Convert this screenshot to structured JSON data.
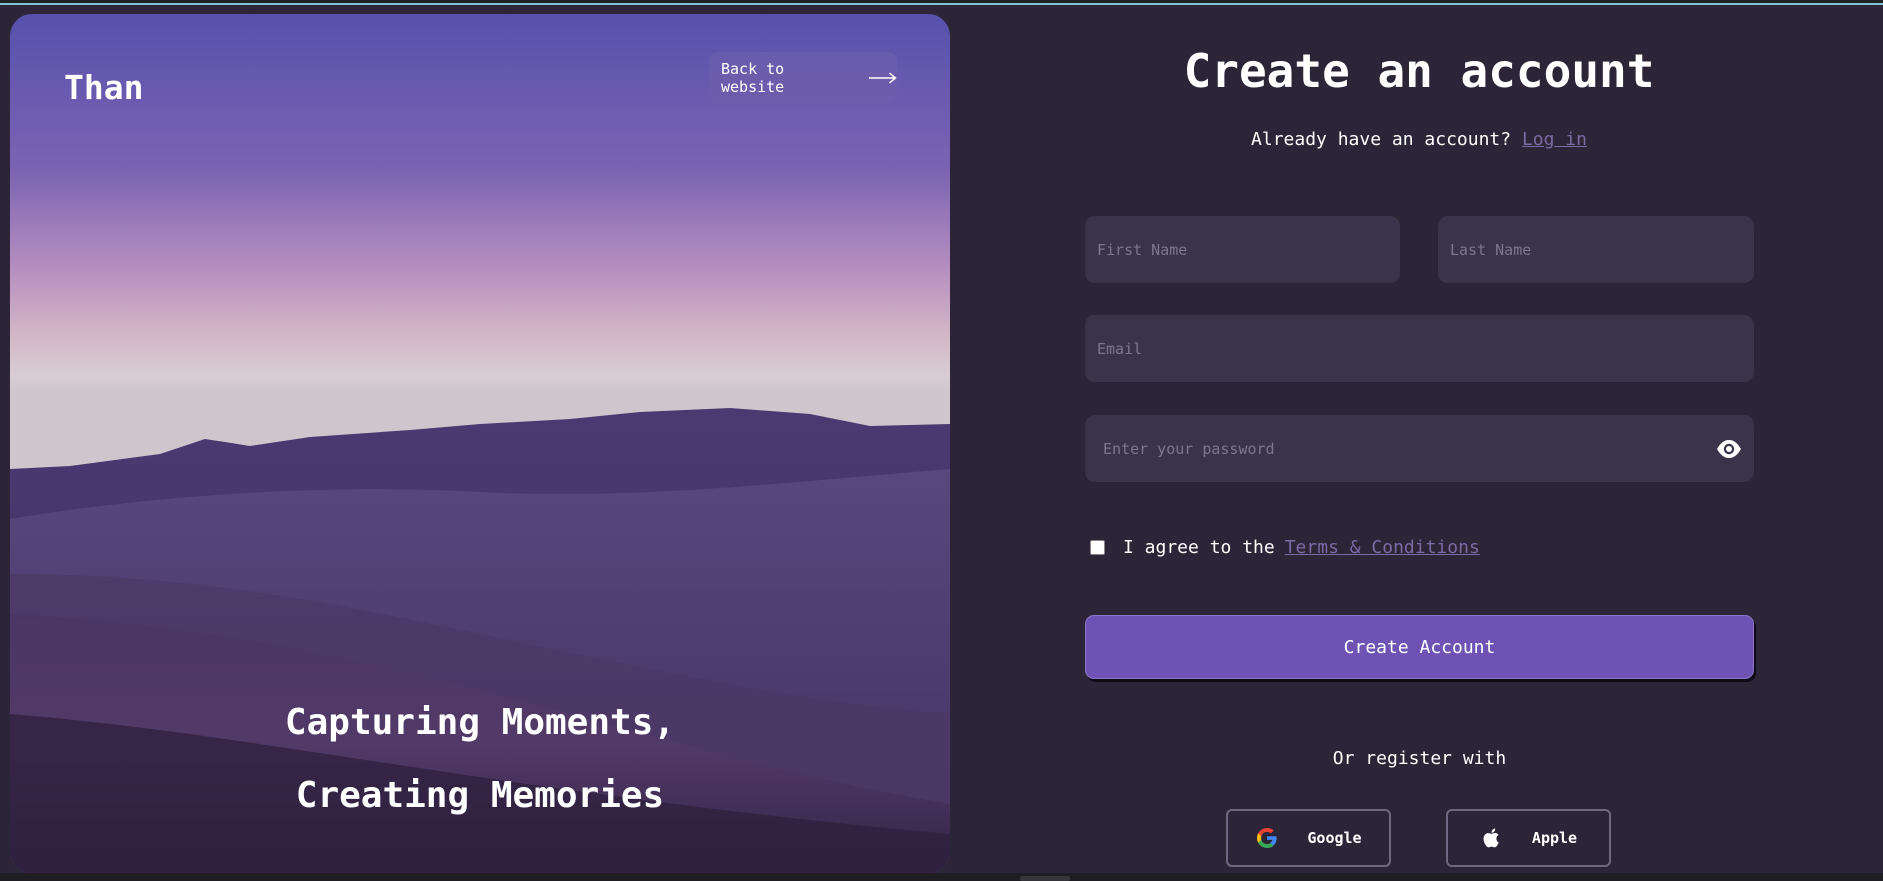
{
  "hero": {
    "brand": "Than",
    "back_label": "Back to website",
    "caption_line1": "Capturing Moments,",
    "caption_line2": "Creating Memories"
  },
  "form": {
    "title": "Create an account",
    "login_prompt": "Already have an account?",
    "login_link": "Log in",
    "first_name_placeholder": "First Name",
    "last_name_placeholder": "Last Name",
    "email_placeholder": "Email",
    "password_placeholder": "Enter your password",
    "terms_prefix": "I agree to the",
    "terms_link": "Terms & Conditions",
    "terms_checked": false,
    "submit_label": "Create Account",
    "alt_register": "Or register with",
    "google_label": "Google",
    "apple_label": "Apple"
  },
  "colors": {
    "background": "#2c2537",
    "input_bg": "#3b3349",
    "accent": "#6e53b5",
    "link": "#7b6aa3"
  },
  "icons": [
    "arrow-right-icon",
    "eye-icon",
    "google-icon",
    "apple-icon"
  ]
}
